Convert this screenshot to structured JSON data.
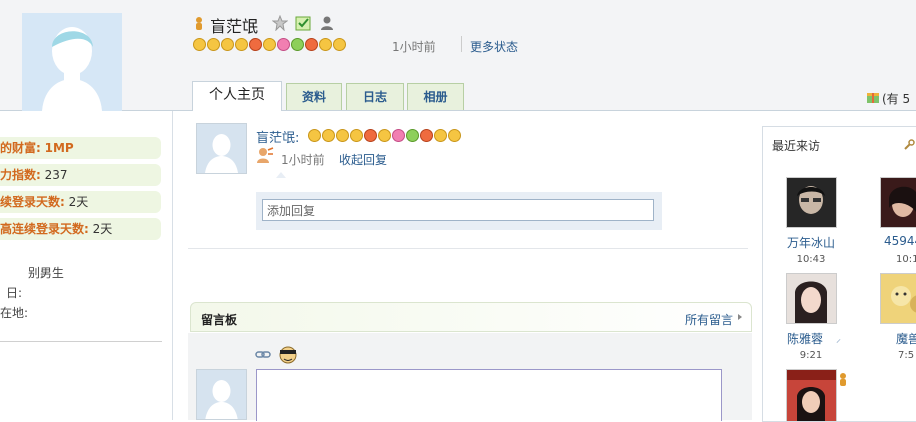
{
  "profile": {
    "name": "盲茫氓",
    "status_time": "1小时前",
    "more_status": "更多状态"
  },
  "tabs": [
    {
      "label": "个人主页"
    },
    {
      "label": "资料"
    },
    {
      "label": "日志"
    },
    {
      "label": "相册"
    }
  ],
  "top_right": {
    "label": "(有 5"
  },
  "stats": [
    {
      "label": "的财富:",
      "value": "1MP"
    },
    {
      "label": "力指数:",
      "value": "237"
    },
    {
      "label": "续登录天数:",
      "value": "2天"
    },
    {
      "label": "高连续登录天数:",
      "value": "2天"
    }
  ],
  "info": [
    {
      "label": "别:",
      "value": "男生"
    },
    {
      "label": "日:",
      "value": ""
    },
    {
      "label": "在地:",
      "value": ""
    }
  ],
  "feed": {
    "author": "盲茫氓:",
    "time": "1小时前",
    "collapse": "收起回复",
    "reply_placeholder": "添加回复"
  },
  "board": {
    "title": "留言板",
    "all_link": "所有留言"
  },
  "visitors": {
    "title": "最近来访",
    "items": [
      {
        "name": "万年冰山",
        "time": "10:43"
      },
      {
        "name": "45944",
        "time": "10:1"
      },
      {
        "name": "陈雅蓉",
        "time": "9:21"
      },
      {
        "name": "魔兽",
        "time": "7:5"
      },
      {
        "name": "",
        "time": ""
      }
    ]
  }
}
